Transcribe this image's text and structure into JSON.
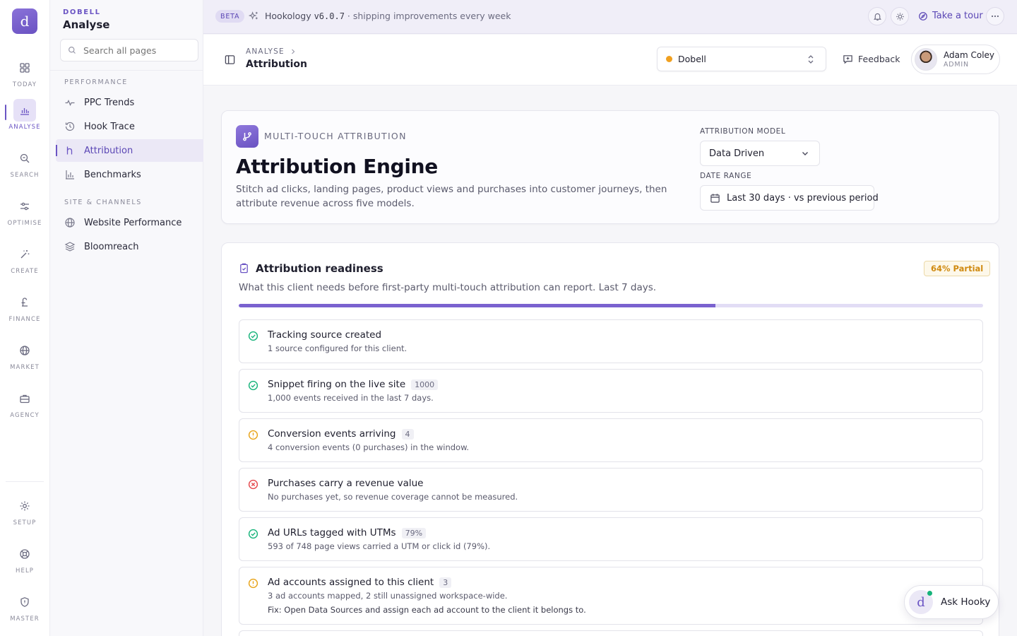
{
  "rail": {
    "logo_glyph": "d",
    "items": [
      {
        "label": "TODAY",
        "icon": "grid-icon"
      },
      {
        "label": "ANALYSE",
        "icon": "bar-chart-icon"
      },
      {
        "label": "SEARCH",
        "icon": "search-icon"
      },
      {
        "label": "OPTIMISE",
        "icon": "sliders-icon"
      },
      {
        "label": "CREATE",
        "icon": "magic-wand-icon"
      },
      {
        "label": "FINANCE",
        "icon": "pound-icon"
      },
      {
        "label": "MARKET",
        "icon": "globe-icon"
      },
      {
        "label": "AGENCY",
        "icon": "briefcase-icon"
      },
      {
        "label": "SETUP",
        "icon": "gear-icon"
      },
      {
        "label": "HELP",
        "icon": "lifebuoy-icon"
      },
      {
        "label": "MASTER",
        "icon": "shield-icon"
      }
    ],
    "active": "ANALYSE"
  },
  "sidebar": {
    "org": "DOBELL",
    "title": "Analyse",
    "search_placeholder": "Search all pages",
    "sections": [
      {
        "label": "PERFORMANCE",
        "items": [
          {
            "label": "PPC Trends",
            "icon": "pulse-icon"
          },
          {
            "label": "Hook Trace",
            "icon": "history-icon"
          },
          {
            "label": "Attribution",
            "icon": "branch-icon"
          },
          {
            "label": "Benchmarks",
            "icon": "bar-chart-icon"
          }
        ]
      },
      {
        "label": "SITE & CHANNELS",
        "items": [
          {
            "label": "Website Performance",
            "icon": "globe-icon"
          },
          {
            "label": "Bloomreach",
            "icon": "layers-icon"
          }
        ]
      }
    ],
    "active_item": "Attribution"
  },
  "topbar": {
    "badge": "BETA",
    "app_name": "Hookology",
    "version": "v6.0.7",
    "tagline": "· shipping improvements every week",
    "tour_label": "Take a tour"
  },
  "header": {
    "breadcrumb_parent": "ANALYSE",
    "page_title": "Attribution",
    "client": "Dobell",
    "client_status_color": "#f0a020",
    "feedback_label": "Feedback",
    "user_name": "Adam Coley",
    "user_role": "ADMIN"
  },
  "hero": {
    "kicker": "MULTI-TOUCH ATTRIBUTION",
    "title": "Attribution Engine",
    "description": "Stitch ad clicks, landing pages, product views and purchases into customer journeys, then attribute revenue across five models.",
    "model_label": "ATTRIBUTION MODEL",
    "model_value": "Data Driven",
    "date_label": "DATE RANGE",
    "date_value": "Last 30 days · vs previous period"
  },
  "readiness": {
    "title": "Attribution readiness",
    "badge": "64% Partial",
    "progress_percent": 64,
    "description": "What this client needs before first-party multi-touch attribution can report. Last 7 days.",
    "checks": [
      {
        "status": "ok",
        "title": "Tracking source created",
        "count": "",
        "detail": "1 source configured for this client.",
        "fix": ""
      },
      {
        "status": "ok",
        "title": "Snippet firing on the live site",
        "count": "1000",
        "detail": "1,000 events received in the last 7 days.",
        "fix": ""
      },
      {
        "status": "warn",
        "title": "Conversion events arriving",
        "count": "4",
        "detail": "4 conversion events (0 purchases) in the window.",
        "fix": ""
      },
      {
        "status": "fail",
        "title": "Purchases carry a revenue value",
        "count": "",
        "detail": "No purchases yet, so revenue coverage cannot be measured.",
        "fix": ""
      },
      {
        "status": "ok",
        "title": "Ad URLs tagged with UTMs",
        "count": "79%",
        "detail": "593 of 748 page views carried a UTM or click id (79%).",
        "fix": ""
      },
      {
        "status": "warn",
        "title": "Ad accounts assigned to this client",
        "count": "3",
        "detail": "3 ad accounts mapped, 2 still unassigned workspace-wide.",
        "fix": "Fix: Open Data Sources and assign each ad account to the client it belongs to."
      }
    ]
  },
  "assistant": {
    "label": "Ask Hooky",
    "glyph": "d"
  },
  "colors": {
    "accent": "#6b55c4",
    "ok": "#16b37a",
    "warn": "#e8a317",
    "fail": "#e5484d"
  }
}
